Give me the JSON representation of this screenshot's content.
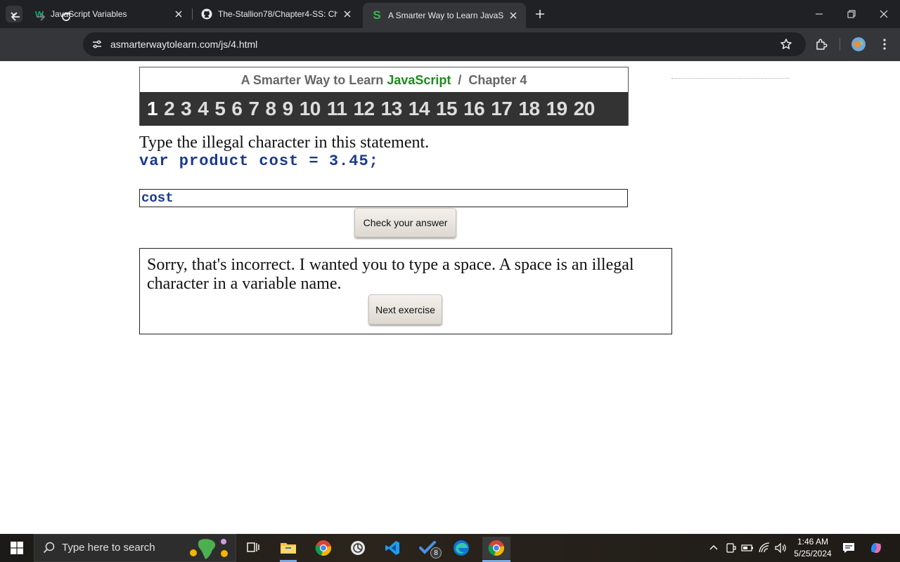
{
  "browser": {
    "tabs": [
      {
        "title": "JavaScript Variables",
        "favicon": "w3schools-icon"
      },
      {
        "title": "The-Stallion78/Chapter4-SS: Ch",
        "favicon": "github-icon"
      },
      {
        "title": "A Smarter Way to Learn JavaScr",
        "favicon": "s-icon",
        "active": true
      }
    ],
    "url": "asmarterwaytolearn.com/js/4.html"
  },
  "page": {
    "header_prefix": "A Smarter Way to Learn ",
    "header_brand": "JavaScript",
    "header_suffix": "  /  Chapter 4",
    "chapters": [
      "1",
      "2",
      "3",
      "4",
      "5",
      "6",
      "7",
      "8",
      "9",
      "10",
      "11",
      "12",
      "13",
      "14",
      "15",
      "16",
      "17",
      "18",
      "19",
      "20"
    ],
    "current_chapter": "1",
    "prompt": "Type the illegal character in this statement.",
    "code": "var product cost = 3.45;",
    "answer_value": "cost",
    "check_button": "Check your answer",
    "feedback": "Sorry, that's incorrect. I wanted you to type a space. A space is an illegal character in a variable name.",
    "next_button": "Next exercise"
  },
  "taskbar": {
    "search_placeholder": "Type here to search",
    "time": "1:46 AM",
    "date": "5/25/2024",
    "todo_badge": "8"
  },
  "colors": {
    "brand_green": "#1b8b1b",
    "chapter_bar": "#333333",
    "code_blue": "#1a3a8f"
  }
}
